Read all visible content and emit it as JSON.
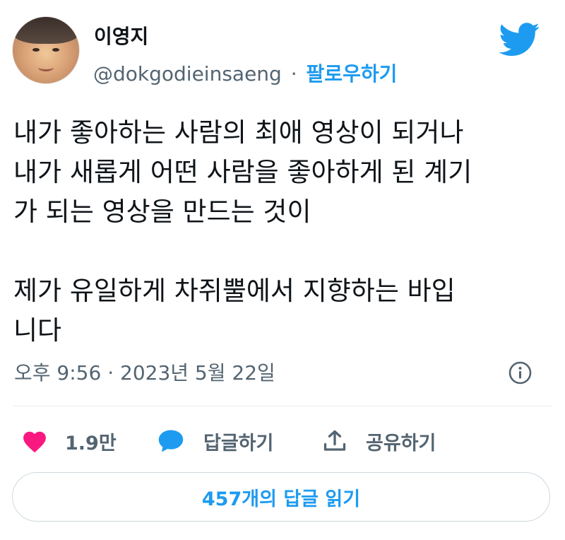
{
  "author": {
    "display_name": "이영지",
    "handle": "@dokgodieinsaeng",
    "separator": "·",
    "follow_label": "팔로우하기"
  },
  "brand": {
    "icon": "twitter-bird-icon",
    "color": "#1d9bf0"
  },
  "tweet": {
    "text": "내가 좋아하는 사람의 최애 영상이 되거나\n내가 새롭게 어떤 사람을 좋아하게 된 계기\n가 되는 영상을 만드는 것이\n\n제가 유일하게 차쥐뿔에서 지향하는 바입\n니다",
    "timestamp": "오후 9:56 · 2023년 5월 22일"
  },
  "actions": {
    "like": {
      "icon": "heart-icon",
      "count": "1.9만",
      "color": "#f91880"
    },
    "reply": {
      "icon": "speech-bubble-icon",
      "label": "답글하기",
      "color": "#1d9bf0"
    },
    "share": {
      "icon": "share-upload-icon",
      "label": "공유하기"
    }
  },
  "replies_button": {
    "label": "457개의 답글 읽기"
  }
}
